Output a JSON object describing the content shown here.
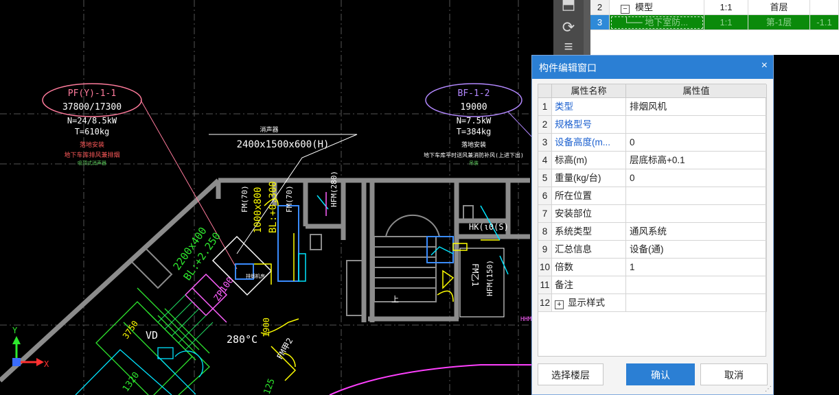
{
  "cad": {
    "tag_left": {
      "line1": "PF(Y)-1-1",
      "line2": "37800/17300",
      "line3": "N=24/8.5kW",
      "line4": "T=610kg",
      "line5": "落地安装",
      "line6": "地下车库排风兼排烟",
      "line7": "吸顶式消声器"
    },
    "tag_right": {
      "line1": "BF-1-2",
      "line2": "19000",
      "line3": "N=7.5kW",
      "line4": "T=384kg",
      "line5": "落地安装",
      "line6": "地下车库平时送风兼消防补风(上进下出)",
      "line7": "吊装"
    },
    "box_title": "消声器",
    "box_dim": "2400x1500x600(H)",
    "labels": {
      "a": "FM(70)",
      "b": "FM(70)",
      "c": "1000x800",
      "d": "BL:+0.300",
      "e": "HFM(280)",
      "f": "2200x400",
      "g": "BL:+2.250",
      "h": "ZP100",
      "i": "280°C",
      "j": "1900",
      "k": "FM甲2",
      "l": "VD",
      "m": "3750",
      "n": "HK(ι0(S)",
      "o": "FM乙1",
      "p": "HFM(150)",
      "q": "上",
      "r": "排烟机房",
      "s": "HHM",
      "t": "1320",
      "u": "125"
    },
    "axis_y": "Y",
    "axis_x": "X"
  },
  "floor_table": {
    "rows": [
      {
        "num": "2",
        "name": "模型",
        "scale": "1:1",
        "floor": "首层",
        "extra": ""
      },
      {
        "num": "3",
        "name": "地下室防...",
        "scale": "1:1",
        "floor": "第-1层",
        "extra": "-1.1"
      }
    ],
    "minus": "−"
  },
  "toolbar": {
    "rotate_icon": "⟳",
    "top_icon": "⬒",
    "menu_icon": "≡"
  },
  "dialog": {
    "title": "构件编辑窗口",
    "close": "×",
    "col_name": "属性名称",
    "col_value": "属性值",
    "rows": [
      {
        "idx": "1",
        "name": "类型",
        "value": "排烟风机"
      },
      {
        "idx": "2",
        "name": "规格型号",
        "value": ""
      },
      {
        "idx": "3",
        "name": "设备高度(m...",
        "value": "0"
      },
      {
        "idx": "4",
        "name": "标高(m)",
        "value": "层底标高+0.1"
      },
      {
        "idx": "5",
        "name": "重量(kg/台)",
        "value": "0"
      },
      {
        "idx": "6",
        "name": "所在位置",
        "value": ""
      },
      {
        "idx": "7",
        "name": "安装部位",
        "value": ""
      },
      {
        "idx": "8",
        "name": "系统类型",
        "value": "通风系统"
      },
      {
        "idx": "9",
        "name": "汇总信息",
        "value": "设备(通)"
      },
      {
        "idx": "10",
        "name": "倍数",
        "value": "1"
      },
      {
        "idx": "11",
        "name": "备注",
        "value": ""
      },
      {
        "idx": "12",
        "name": "显示样式",
        "value": ""
      }
    ],
    "plus": "+",
    "btn_floor": "选择楼层",
    "btn_ok": "确认",
    "btn_cancel": "取消",
    "grip": "⋰"
  }
}
